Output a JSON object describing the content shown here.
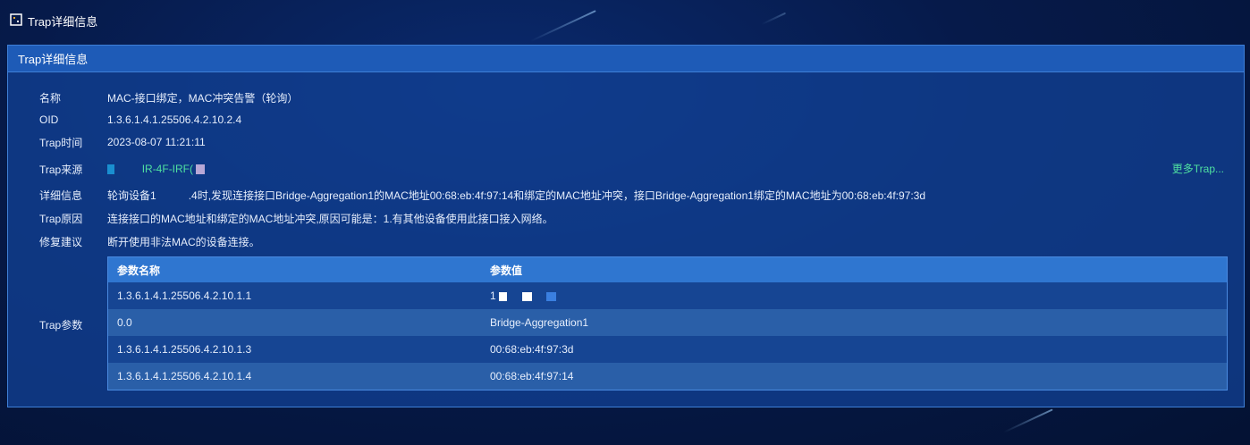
{
  "window": {
    "title": "Trap详细信息"
  },
  "panel": {
    "title": "Trap详细信息"
  },
  "fields": {
    "name_label": "名称",
    "name_value": "MAC-接口绑定，MAC冲突告警（轮询）",
    "oid_label": "OID",
    "oid_value": "1.3.6.1.4.1.25506.4.2.10.2.4",
    "time_label": "Trap时间",
    "time_value": "2023-08-07 11:21:11",
    "source_label": "Trap来源",
    "source_value": "IR-4F-IRF(",
    "detail_label": "详细信息",
    "detail_prefix": "轮询设备1",
    "detail_value": ".4时,发现连接接口Bridge-Aggregation1的MAC地址00:68:eb:4f:97:14和绑定的MAC地址冲突，接口Bridge-Aggregation1绑定的MAC地址为00:68:eb:4f:97:3d",
    "cause_label": "Trap原因",
    "cause_value": "连接接口的MAC地址和绑定的MAC地址冲突,原因可能是：1.有其他设备使用此接口接入网络。",
    "fix_label": "修复建议",
    "fix_value": "断开使用非法MAC的设备连接。",
    "params_label": "Trap参数"
  },
  "more_link": "更多Trap...",
  "params_table": {
    "headers": [
      "参数名称",
      "参数值"
    ],
    "rows": [
      {
        "name": "1.3.6.1.4.1.25506.4.2.10.1.1",
        "value": "1"
      },
      {
        "name": "0.0",
        "value": "Bridge-Aggregation1"
      },
      {
        "name": "1.3.6.1.4.1.25506.4.2.10.1.3",
        "value": "00:68:eb:4f:97:3d"
      },
      {
        "name": "1.3.6.1.4.1.25506.4.2.10.1.4",
        "value": "00:68:eb:4f:97:14"
      }
    ]
  },
  "colors": {
    "accent_green": "#4fe0a0",
    "header_blue": "#2f76d0"
  }
}
